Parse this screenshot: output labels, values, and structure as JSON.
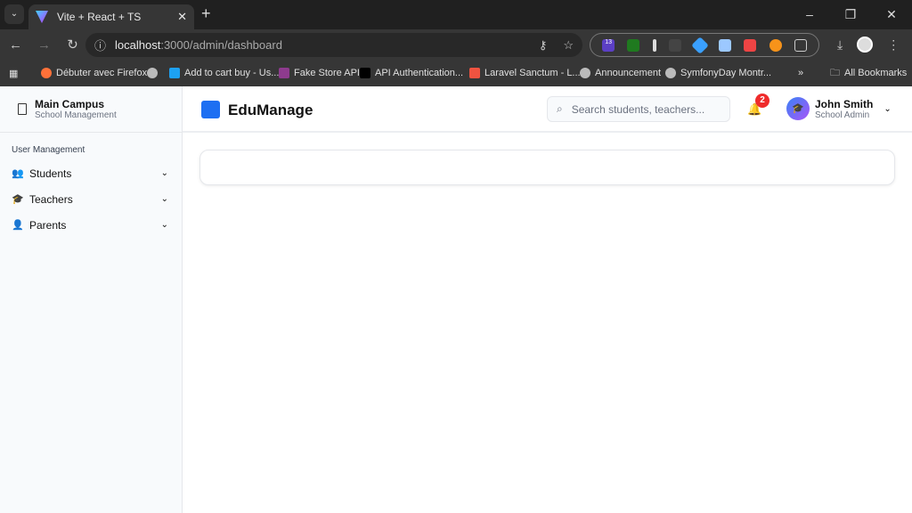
{
  "browser": {
    "tab_title": "Vite + React + TS",
    "url_host": "localhost",
    "url_path": ":3000/admin/dashboard",
    "bookmarks": [
      "Débuter avec Firefox",
      "Add to cart buy - Us...",
      "Fake Store API",
      "API Authentication...",
      "Laravel Sanctum - L...",
      "Announcement",
      "SymfonyDay Montr..."
    ],
    "all_bookmarks": "All Bookmarks",
    "ext_badge": "13"
  },
  "sidebar": {
    "campus_name": "Main Campus",
    "campus_sub": "School Management",
    "section": "User Management",
    "items": [
      {
        "label": "Students",
        "icon": "users-icon"
      },
      {
        "label": "Teachers",
        "icon": "graduation-cap-icon"
      },
      {
        "label": "Parents",
        "icon": "user-icon"
      }
    ]
  },
  "header": {
    "brand": "EduManage",
    "search_placeholder": "Search students, teachers...",
    "notifications": "2",
    "user_name": "John Smith",
    "user_role": "School Admin"
  },
  "colors": {
    "accent": "#1d6ff2",
    "badge": "#ef2b2b"
  }
}
